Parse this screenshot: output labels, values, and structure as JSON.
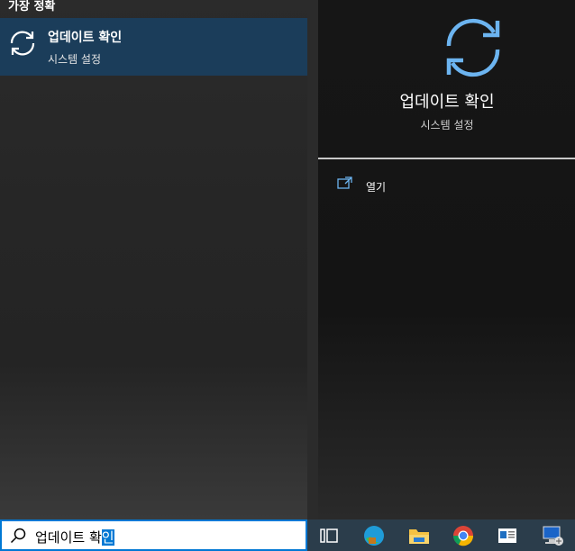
{
  "left": {
    "section_header": "가장 정확",
    "best_match": {
      "title": "업데이트 확인",
      "subtitle": "시스템 설정",
      "icon": "refresh-icon"
    }
  },
  "right": {
    "title": "업데이트 확인",
    "subtitle": "시스템 설정",
    "icon": "refresh-icon",
    "actions": [
      {
        "label": "열기",
        "icon": "open-icon"
      }
    ]
  },
  "search": {
    "typed": "업데이트 확",
    "composing": "인"
  },
  "taskbar": {
    "items": [
      "task-view-icon",
      "edge-icon",
      "file-explorer-icon",
      "chrome-icon",
      "news-icon",
      "network-computer-icon"
    ]
  },
  "colors": {
    "accent": "#0078d4",
    "selection": "#1b3d5a",
    "icon_blue": "#6cb4f0"
  }
}
